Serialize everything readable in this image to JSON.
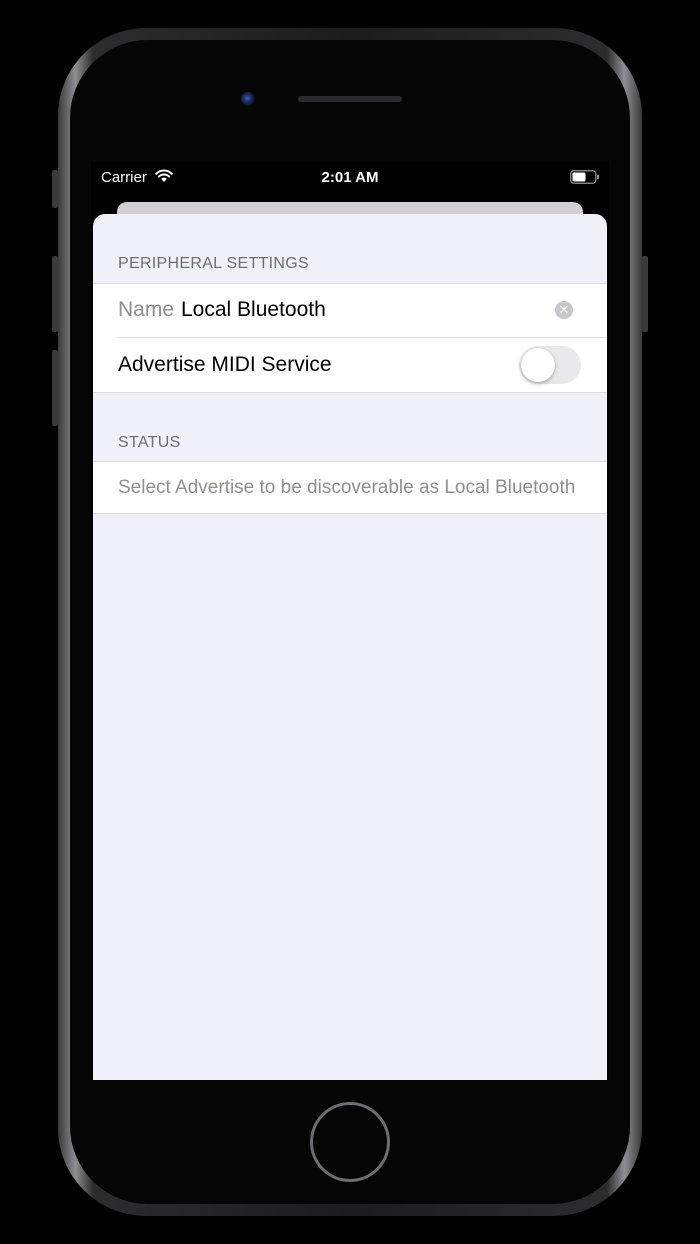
{
  "status_bar": {
    "carrier": "Carrier",
    "time": "2:01 AM"
  },
  "peripheral_settings": {
    "header": "PERIPHERAL SETTINGS",
    "name_label": "Name",
    "name_value": "Local Bluetooth",
    "advertise_label": "Advertise MIDI Service",
    "advertise_on": false
  },
  "status_section": {
    "header": "STATUS",
    "message": "Select Advertise to be discoverable as Local Bluetooth"
  },
  "icons": {
    "wifi": "wifi-icon",
    "battery": "battery-icon",
    "clear": "clear-icon"
  },
  "colors": {
    "background": "#f0f0f8",
    "cell": "#ffffff",
    "secondary_text": "#8e8e93",
    "toggle_off": "#e9e9eb"
  }
}
